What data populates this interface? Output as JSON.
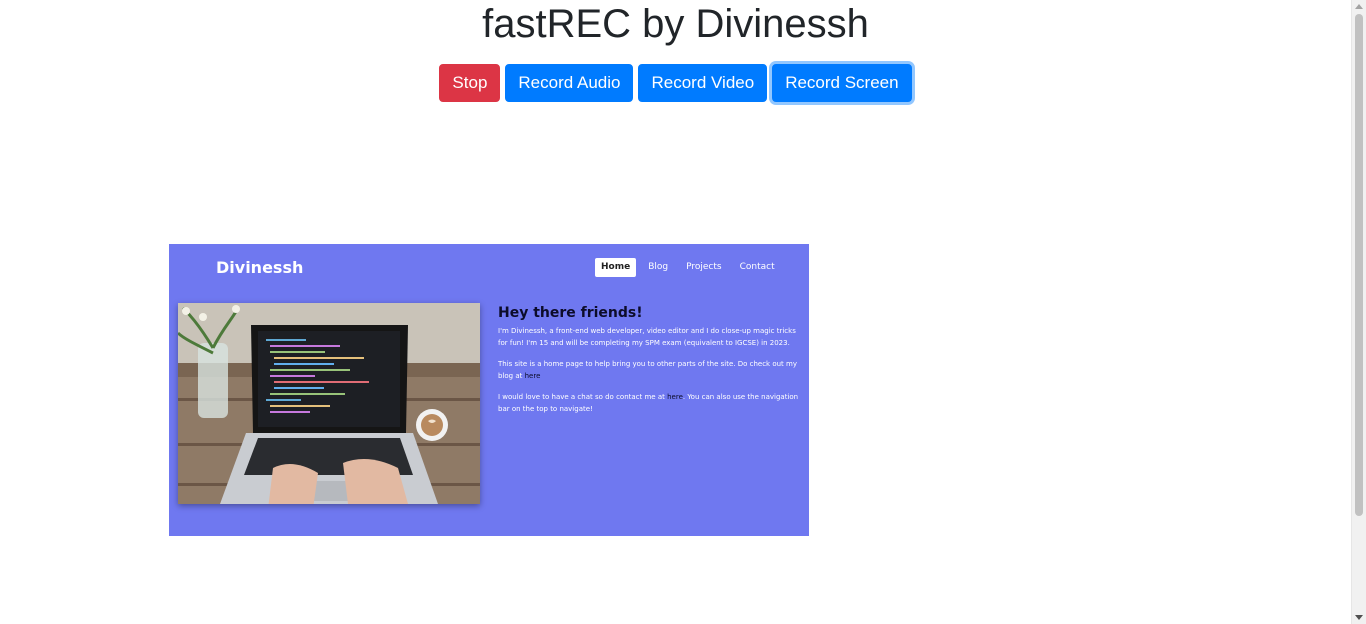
{
  "title": "fastREC by Divinessh",
  "toolbar": {
    "stop": "Stop",
    "record_audio": "Record Audio",
    "record_video": "Record Video",
    "record_screen": "Record Screen"
  },
  "colors": {
    "danger": "#dc3545",
    "primary": "#007bff",
    "preview_bg": "#6f78f0"
  },
  "preview": {
    "brand": "Divinessh",
    "nav": [
      "Home",
      "Blog",
      "Projects",
      "Contact"
    ],
    "active_nav": "Home",
    "heading": "Hey there friends!",
    "para1": "I'm Divinessh, a front-end web developer, video editor and I do close-up magic tricks for fun! I'm 15 and will be completing my SPM exam (equivalent to IGCSE) in 2023.",
    "para2_before": "This site is a home page to help bring you to other parts of the site. Do check out my blog at ",
    "para2_link": "here",
    "para3_before": "I would love to have a chat so do contact me at ",
    "para3_link": "here",
    "para3_after": ". You can also use the navigation bar on the top to navigate!"
  }
}
